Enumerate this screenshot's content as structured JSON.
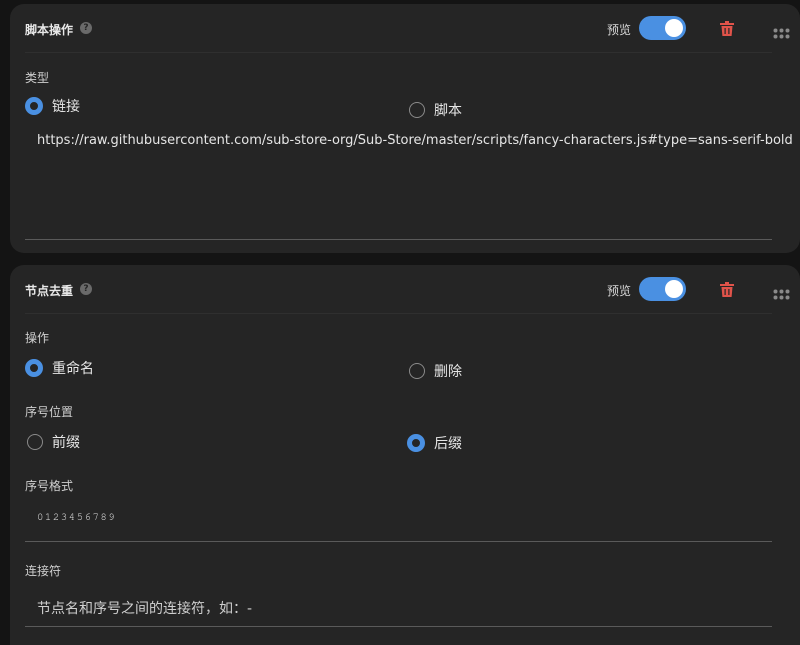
{
  "colors": {
    "accent": "#4a90e2",
    "danger": "#e0534a",
    "card": "#252525",
    "background": "#141414"
  },
  "card_script": {
    "title": "脚本操作",
    "help_icon": "?",
    "preview_label": "预览",
    "preview_enabled": true,
    "type_label": "类型",
    "options": [
      {
        "label": "链接",
        "checked": true
      },
      {
        "label": "脚本",
        "checked": false
      }
    ],
    "url_value": "https://raw.githubusercontent.com/sub-store-org/Sub-Store/master/scripts/fancy-characters.js#type=sans-serif-bold"
  },
  "card_dedupe": {
    "title": "节点去重",
    "help_icon": "?",
    "preview_label": "预览",
    "preview_enabled": true,
    "action_label": "操作",
    "action_options": [
      {
        "label": "重命名",
        "checked": true
      },
      {
        "label": "删除",
        "checked": false
      }
    ],
    "position_label": "序号位置",
    "position_options": [
      {
        "label": "前缀",
        "checked": false
      },
      {
        "label": "后缀",
        "checked": true
      }
    ],
    "format_label": "序号格式",
    "format_value": "𝟶𝟷𝟸𝟹𝟺𝟻𝟼𝟽𝟾𝟿",
    "joiner_label": "连接符",
    "joiner_placeholder": "节点名和序号之间的连接符，如：-"
  }
}
